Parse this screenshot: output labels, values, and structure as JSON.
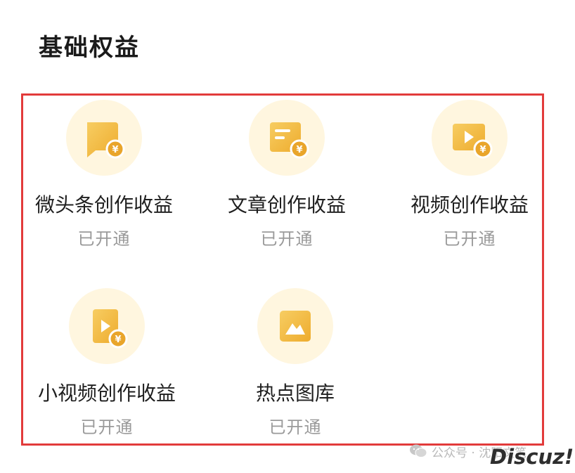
{
  "section": {
    "title": "基础权益"
  },
  "items": [
    {
      "label": "微头条创作收益",
      "status": "已开通",
      "icon": "chat-bubble-yuan-icon"
    },
    {
      "label": "文章创作收益",
      "status": "已开通",
      "icon": "document-yuan-icon"
    },
    {
      "label": "视频创作收益",
      "status": "已开通",
      "icon": "video-play-yuan-icon"
    },
    {
      "label": "小视频创作收益",
      "status": "已开通",
      "icon": "short-video-yuan-icon"
    },
    {
      "label": "热点图库",
      "status": "已开通",
      "icon": "image-gallery-icon"
    }
  ],
  "watermark": {
    "text": "公众号 · 沈阳文笔",
    "brand": "Discuz!"
  },
  "colors": {
    "icon_gold": "#f2b73c",
    "icon_bg": "#fff6df",
    "highlight_border": "#e23b3b",
    "status_gray": "#9a9a9a"
  }
}
